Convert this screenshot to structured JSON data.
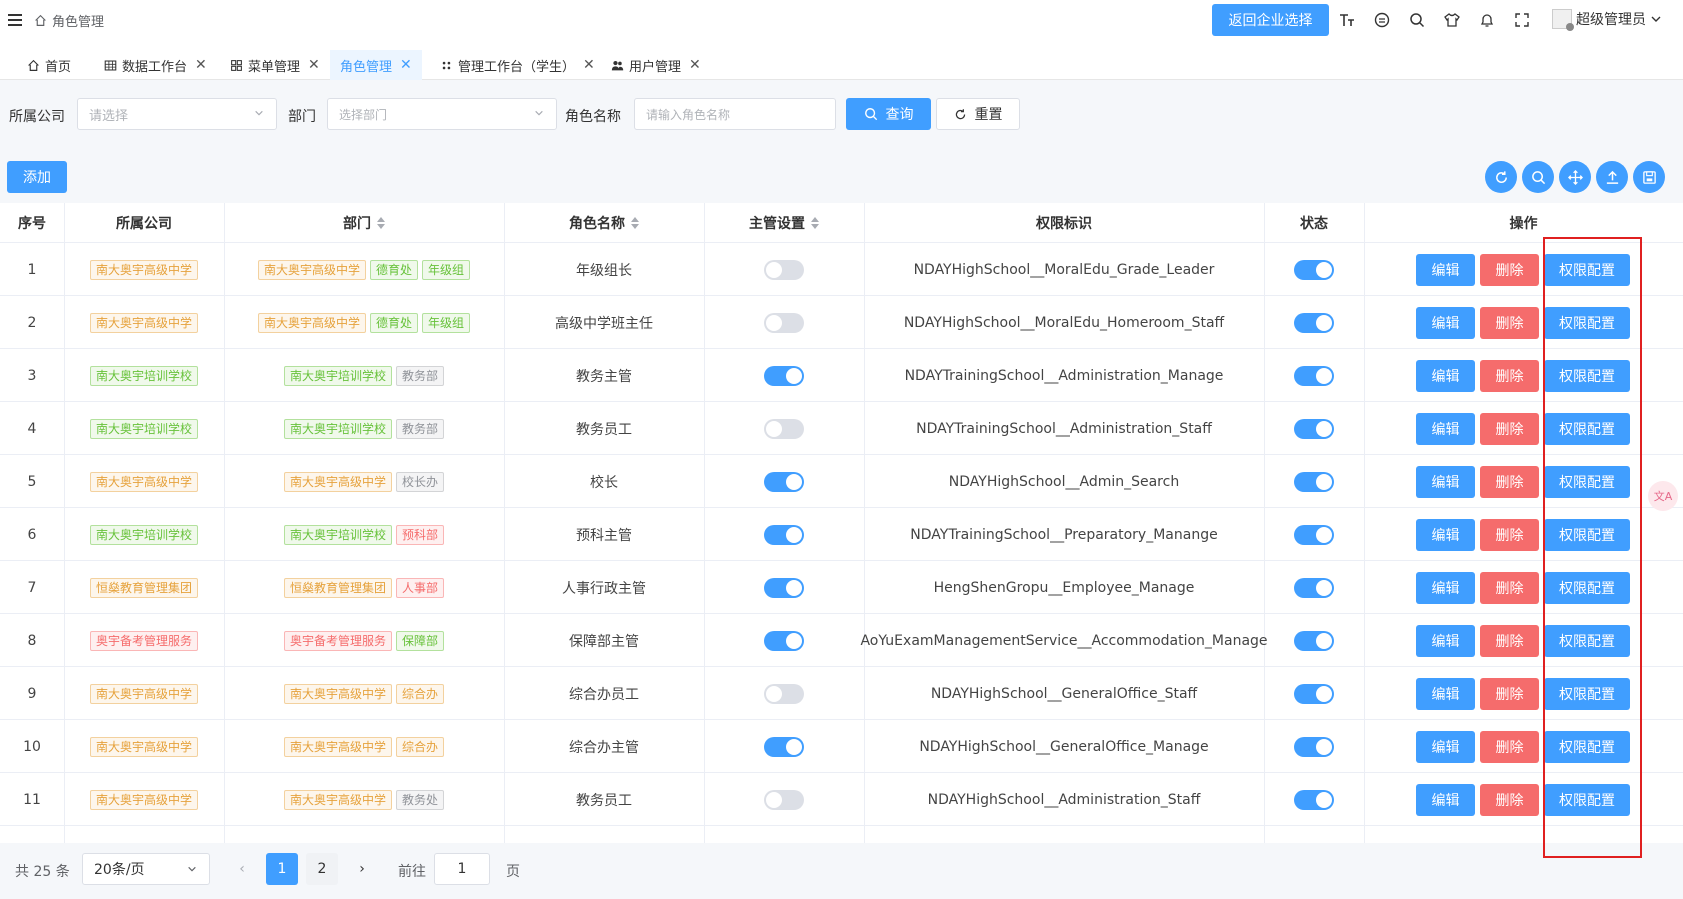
{
  "header": {
    "breadcrumb": "角色管理",
    "return_button": "返回企业选择",
    "icons": [
      "font-size-icon",
      "github-icon",
      "search-icon",
      "theme-shirt-icon",
      "bell-icon",
      "fullscreen-icon"
    ],
    "user_name": "超级管理员"
  },
  "tabs": [
    {
      "label": "首页",
      "icon": "home-icon",
      "closable": false,
      "active": false
    },
    {
      "label": "数据工作台",
      "icon": "table-icon",
      "closable": true,
      "active": false
    },
    {
      "label": "菜单管理",
      "icon": "grid-icon",
      "closable": true,
      "active": false
    },
    {
      "label": "角色管理",
      "icon": "",
      "closable": true,
      "active": true
    },
    {
      "label": "管理工作台（学生）",
      "icon": "dots-icon",
      "closable": true,
      "active": false
    },
    {
      "label": "用户管理",
      "icon": "users-icon",
      "closable": true,
      "active": false
    }
  ],
  "filters": {
    "company_label": "所属公司",
    "company_placeholder": "请选择",
    "dept_label": "部门",
    "dept_placeholder": "选择部门",
    "role_label": "角色名称",
    "role_placeholder": "请输入角色名称",
    "query_button": "查询",
    "reset_button": "重置"
  },
  "toolbar": {
    "add_button": "添加",
    "tools": [
      "refresh-icon",
      "search-icon",
      "move-icon",
      "upload-icon",
      "save-icon"
    ]
  },
  "table": {
    "headers": {
      "index": "序号",
      "company": "所属公司",
      "dept": "部门",
      "role": "角色名称",
      "manager": "主管设置",
      "perm": "权限标识",
      "status": "状态",
      "actions": "操作"
    },
    "actions": {
      "edit": "编辑",
      "delete": "删除",
      "perm": "权限配置"
    },
    "rows": [
      {
        "index": "1",
        "company": {
          "text": "南大奥宇高级中学",
          "color": "orange"
        },
        "dept": [
          {
            "text": "南大奥宇高级中学",
            "color": "orange"
          },
          {
            "text": "德育处",
            "color": "green"
          },
          {
            "text": "年级组",
            "color": "green"
          }
        ],
        "role": "年级组长",
        "manager": false,
        "perm": "NDAYHighSchool__MoralEdu_Grade_Leader",
        "status": true
      },
      {
        "index": "2",
        "company": {
          "text": "南大奥宇高级中学",
          "color": "orange"
        },
        "dept": [
          {
            "text": "南大奥宇高级中学",
            "color": "orange"
          },
          {
            "text": "德育处",
            "color": "green"
          },
          {
            "text": "年级组",
            "color": "green"
          }
        ],
        "role": "高级中学班主任",
        "manager": false,
        "perm": "NDAYHighSchool__MoralEdu_Homeroom_Staff",
        "status": true
      },
      {
        "index": "3",
        "company": {
          "text": "南大奥宇培训学校",
          "color": "green"
        },
        "dept": [
          {
            "text": "南大奥宇培训学校",
            "color": "green"
          },
          {
            "text": "教务部",
            "color": "gray"
          }
        ],
        "role": "教务主管",
        "manager": true,
        "perm": "NDAYTrainingSchool__Administration_Manage",
        "status": true
      },
      {
        "index": "4",
        "company": {
          "text": "南大奥宇培训学校",
          "color": "green"
        },
        "dept": [
          {
            "text": "南大奥宇培训学校",
            "color": "green"
          },
          {
            "text": "教务部",
            "color": "gray"
          }
        ],
        "role": "教务员工",
        "manager": false,
        "perm": "NDAYTrainingSchool__Administration_Staff",
        "status": true
      },
      {
        "index": "5",
        "company": {
          "text": "南大奥宇高级中学",
          "color": "orange"
        },
        "dept": [
          {
            "text": "南大奥宇高级中学",
            "color": "orange"
          },
          {
            "text": "校长办",
            "color": "gray"
          }
        ],
        "role": "校长",
        "manager": true,
        "perm": "NDAYHighSchool__Admin_Search",
        "status": true
      },
      {
        "index": "6",
        "company": {
          "text": "南大奥宇培训学校",
          "color": "green"
        },
        "dept": [
          {
            "text": "南大奥宇培训学校",
            "color": "green"
          },
          {
            "text": "预科部",
            "color": "red"
          }
        ],
        "role": "预科主管",
        "manager": true,
        "perm": "NDAYTrainingSchool__Preparatory_Manange",
        "status": true
      },
      {
        "index": "7",
        "company": {
          "text": "恒燊教育管理集团",
          "color": "orange"
        },
        "dept": [
          {
            "text": "恒燊教育管理集团",
            "color": "orange"
          },
          {
            "text": "人事部",
            "color": "red"
          }
        ],
        "role": "人事行政主管",
        "manager": true,
        "perm": "HengShenGropu__Employee_Manage",
        "status": true
      },
      {
        "index": "8",
        "company": {
          "text": "奥宇备考管理服务",
          "color": "red"
        },
        "dept": [
          {
            "text": "奥宇备考管理服务",
            "color": "red"
          },
          {
            "text": "保障部",
            "color": "green"
          }
        ],
        "role": "保障部主管",
        "manager": true,
        "perm": "AoYuExamManagementService__Accommodation_Manage",
        "status": true
      },
      {
        "index": "9",
        "company": {
          "text": "南大奥宇高级中学",
          "color": "orange"
        },
        "dept": [
          {
            "text": "南大奥宇高级中学",
            "color": "orange"
          },
          {
            "text": "综合办",
            "color": "orange"
          }
        ],
        "role": "综合办员工",
        "manager": false,
        "perm": "NDAYHighSchool__GeneralOffice_Staff",
        "status": true
      },
      {
        "index": "10",
        "company": {
          "text": "南大奥宇高级中学",
          "color": "orange"
        },
        "dept": [
          {
            "text": "南大奥宇高级中学",
            "color": "orange"
          },
          {
            "text": "综合办",
            "color": "orange"
          }
        ],
        "role": "综合办主管",
        "manager": true,
        "perm": "NDAYHighSchool__GeneralOffice_Manage",
        "status": true
      },
      {
        "index": "11",
        "company": {
          "text": "南大奥宇高级中学",
          "color": "orange"
        },
        "dept": [
          {
            "text": "南大奥宇高级中学",
            "color": "orange"
          },
          {
            "text": "教务处",
            "color": "gray"
          }
        ],
        "role": "教务员工",
        "manager": false,
        "perm": "NDAYHighSchool__Administration_Staff",
        "status": true
      }
    ]
  },
  "pagination": {
    "total": "共 25 条",
    "page_size": "20条/页",
    "pages": [
      "1",
      "2"
    ],
    "current": "1",
    "goto_label": "前往",
    "goto_value": "1",
    "page_suffix": "页"
  },
  "colors": {
    "primary": "#409eff",
    "danger": "#f56c6c",
    "highlight_box": "#e02020"
  }
}
